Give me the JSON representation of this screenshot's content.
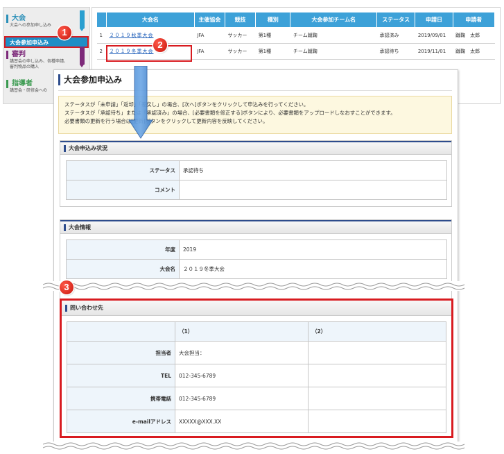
{
  "menu": {
    "section1": {
      "title": "大会",
      "desc": "大会への参加申し込み"
    },
    "active_item": "大会参加申込み",
    "section2": {
      "title": "審判",
      "desc1": "講習会の申し込み、各種申請、",
      "desc2": "審判物品の購入"
    },
    "section3": {
      "title": "指導者",
      "desc": "講習会・研修会への"
    }
  },
  "list": {
    "headers": [
      "",
      "大会名",
      "主催協会",
      "競技",
      "種別",
      "大会参加チーム名",
      "ステータス",
      "申請日",
      "申請者"
    ],
    "rows": [
      [
        "1",
        "２０１９秋季大会",
        "JFA",
        "サッカー",
        "第1種",
        "チーム蹴鞠",
        "承認済み",
        "2019/09/01",
        "蹴鞠　太郎"
      ],
      [
        "2",
        "２０１９冬季大会",
        "JFA",
        "サッカー",
        "第1種",
        "チーム蹴鞠",
        "承認待ち",
        "2019/11/01",
        "蹴鞠　太郎"
      ]
    ]
  },
  "panel": {
    "title": "大会参加申込み",
    "notice": [
      "ステータスが「未申請」「返却」「差戻し」の場合、[次へ]ボタンをクリックして申込みを行ってください。",
      "ステータスが「承認待ち」または「承認済み」の場合、[必要書類を修正する]ボタンにより、必要書類をアップロードしなおすことができます。",
      "必要書類の更新を行う場合は[更新]ボタンをクリックして更新内容を反映してください。"
    ],
    "status_section": {
      "title": "大会申込み状況",
      "status_label": "ステータス",
      "status_value": "承認待ち",
      "comment_label": "コメント",
      "comment_value": ""
    },
    "info_section": {
      "title": "大会情報",
      "year_label": "年度",
      "year_value": "2019",
      "name_label": "大会名",
      "name_value": "２０１９冬季大会"
    },
    "contact_section": {
      "title": "問い合わせ先",
      "col1": "（1）",
      "col2": "（2）",
      "rows": [
        {
          "label": "担当者",
          "v1": "大会担当：",
          "v2": ""
        },
        {
          "label": "TEL",
          "v1": "012-345-6789",
          "v2": ""
        },
        {
          "label": "携帯電話",
          "v1": "012-345-6789",
          "v2": ""
        },
        {
          "label": "e-mailアドレス",
          "v1": "XXXXX@XXX.XX",
          "v2": ""
        }
      ]
    }
  },
  "callouts": [
    "1",
    "2",
    "3"
  ],
  "colors": {
    "accent_blue": "#3da1d8",
    "highlight_red": "#d81b20",
    "notice_bg": "#fdf8e0"
  }
}
